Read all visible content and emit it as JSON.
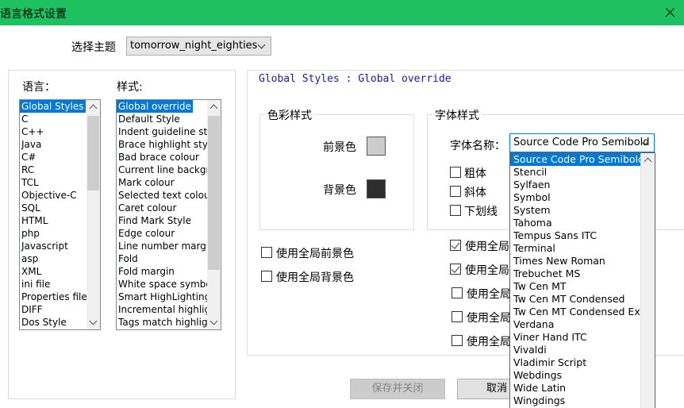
{
  "window": {
    "title": "语言格式设置"
  },
  "theme": {
    "label": "选择主题",
    "value": "tomorrow_night_eighties"
  },
  "languages": {
    "label": "语言：",
    "items": [
      "Global Styles",
      "C",
      "C++",
      "Java",
      "C#",
      "RC",
      "TCL",
      "Objective-C",
      "SQL",
      "HTML",
      "php",
      "Javascript",
      "asp",
      "XML",
      "ini file",
      "Properties file",
      "DIFF",
      "Dos Style"
    ],
    "selected": "Global Styles"
  },
  "styles": {
    "label": "样式:",
    "items": [
      "Global override",
      "Default Style",
      "Indent guideline style",
      "Brace highlight style",
      "Bad brace colour",
      "Current line background",
      "Mark colour",
      "Selected text colour",
      "Caret colour",
      "Find Mark Style",
      "Edge colour",
      "Line number margin",
      "Fold",
      "Fold margin",
      "White space symbol",
      "Smart HighLighting",
      "Incremental highlight",
      "Tags match highlight"
    ],
    "selected": "Global override"
  },
  "header": "Global Styles : Global override",
  "color_group": {
    "label": "色彩样式",
    "fg_label": "前景色",
    "fg_color": "#cccccc",
    "bg_label": "背景色",
    "bg_color": "#2d2d2d"
  },
  "font_group": {
    "label": "字体样式",
    "name_label": "字体名称：",
    "name_value": "Source Code Pro Semibold",
    "bold": "粗体",
    "italic": "斜体",
    "underline": "下划线"
  },
  "global_fg": "使用全局前景色",
  "global_bg": "使用全局背景色",
  "global_right": [
    "使用全局",
    "使用全局",
    "使用全局",
    "使用全局",
    "使用全局"
  ],
  "font_list": {
    "selected": "Source Code Pro Semibold",
    "items": [
      "Source Code Pro Semibold",
      "Stencil",
      "Sylfaen",
      "Symbol",
      "System",
      "Tahoma",
      "Tempus Sans ITC",
      "Terminal",
      "Times New Roman",
      "Trebuchet MS",
      "Tw Cen MT",
      "Tw Cen MT Condensed",
      "Tw Cen MT Condensed Extra Bold",
      "Verdana",
      "Viner Hand ITC",
      "Vivaldi",
      "Vladimir Script",
      "Webdings",
      "Wide Latin",
      "Wingdings"
    ]
  },
  "buttons": {
    "save_close": "保存并关闭",
    "cancel": "取消"
  }
}
